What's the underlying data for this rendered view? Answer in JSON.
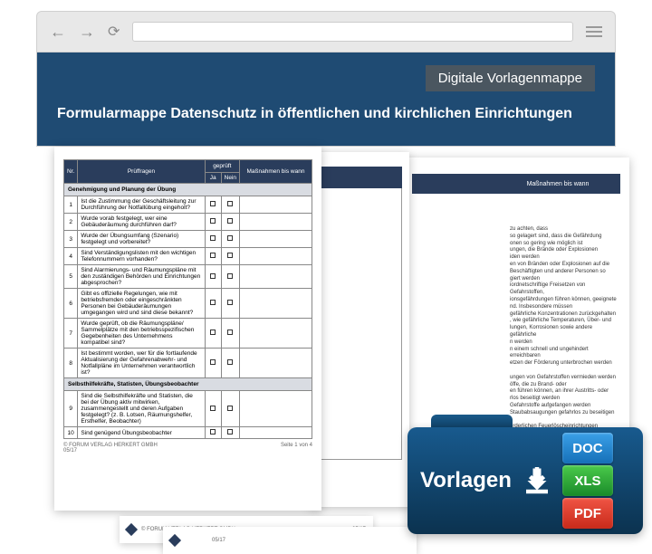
{
  "chrome": {
    "url": ""
  },
  "header": {
    "badge": "Digitale Vorlagenmappe",
    "title": "Formularmappe Datenschutz in öffentlichen und kirchlichen Einrichtungen"
  },
  "doc1": {
    "columns": {
      "nr": "Nr.",
      "frage": "Prüffragen",
      "geprueft": "geprüft",
      "ja": "Ja",
      "nein": "Nein",
      "massnahmen": "Maßnahmen bis wann"
    },
    "section1": "Genehmigung und Planung der Übung",
    "rows1": [
      {
        "nr": "1",
        "txt": "Ist die Zustimmung der Geschäftsleitung zur Durchführung der Notfallübung eingeholt?"
      },
      {
        "nr": "2",
        "txt": "Wurde vorab festgelegt, wer eine Gebäuderäumung durchführen darf?"
      },
      {
        "nr": "3",
        "txt": "Wurde der Übungsumfang (Szenario) festgelegt und vorbereitet?"
      },
      {
        "nr": "4",
        "txt": "Sind Verständigungslisten mit den wichtigen Telefonnummern vorhanden?"
      },
      {
        "nr": "5",
        "txt": "Sind Alarmierungs- und Räumungspläne mit den zuständigen Behörden und Einrichtungen abgesprochen?"
      },
      {
        "nr": "6",
        "txt": "Gibt es offizielle Regelungen, wie mit betriebsfremden oder eingeschränkten Personen bei Gebäuderäumungen umgegangen wird und sind diese bekannt?"
      },
      {
        "nr": "7",
        "txt": "Wurde geprüft, ob die Räumungspläne/ Sammelplätze mit den betriebsspezifischen Gegebenheiten des Unternehmens kompatibel sind?"
      },
      {
        "nr": "8",
        "txt": "Ist bestimmt worden, wer für die fortlaufende Aktualisierung der Gefahrenabwehr- und Notfallpläne im Unternehmen verantwortlich ist?"
      }
    ],
    "section2": "Selbsthilfekräfte, Statisten, Übungsbeobachter",
    "rows2": [
      {
        "nr": "9",
        "txt": "Sind die Selbsthilfekräfte und Statisten, die bei der Übung aktiv mitwirken, zusammengestellt und deren Aufgaben festgelegt? (z. B. Lotsen, Räumungshelfer, Ersthelfer, Beobachter)"
      },
      {
        "nr": "10",
        "txt": "Sind genügend Übungsbeobachter"
      }
    ],
    "footer_left": "© FORUM VERLAG HERKERT GMBH",
    "footer_right": "Seite 1 von 4",
    "footer_date": "05/17"
  },
  "doc2": {
    "header": "Maßnahmen bis wann"
  },
  "doc3": {
    "text": "zu achten, dass\nso gelagert sind, dass die Gefährdung\nonen so gering wie möglich ist\nungen, die Brände oder Explosionen\niden werden\nen von Bränden oder Explosionen auf die\nBeschäftigten und anderer Personen so\ngiert werden\niordnetschriftige Freisetzen von Gefahrstoffen,\nionsgefährdungen führen können, geeignete\nnd. Insbesondere müssen\ngefährliche Konzentrationen zurückgehalten\n, wie gefährliche Temperaturen, Über- und\nlungen, Korrosionen sowie andere gefährliche\nn werden\nn einem schnell und ungehindert erreichbaren\netzen der Förderung unterbrochen werden\n\nungen von Gefahrstoffen vermieden werden\nöffe, die zu Brand- oder\nen führen können, an ihrer Austritts- oder\nrlos beseitigt werden\nGefahrstoffe aufgefangen werden\nStaubabsaugungen gefahrlos zu beseitigen\n\norderlichen Feuerlöscheinrichtungen vorhanden"
  },
  "peek": {
    "copyright": "© FORUM VERLAG HERKERT GMBH",
    "date": "05/17"
  },
  "folder": {
    "label": "Vorlagen",
    "formats": {
      "doc": "DOC",
      "xls": "XLS",
      "pdf": "PDF"
    }
  }
}
